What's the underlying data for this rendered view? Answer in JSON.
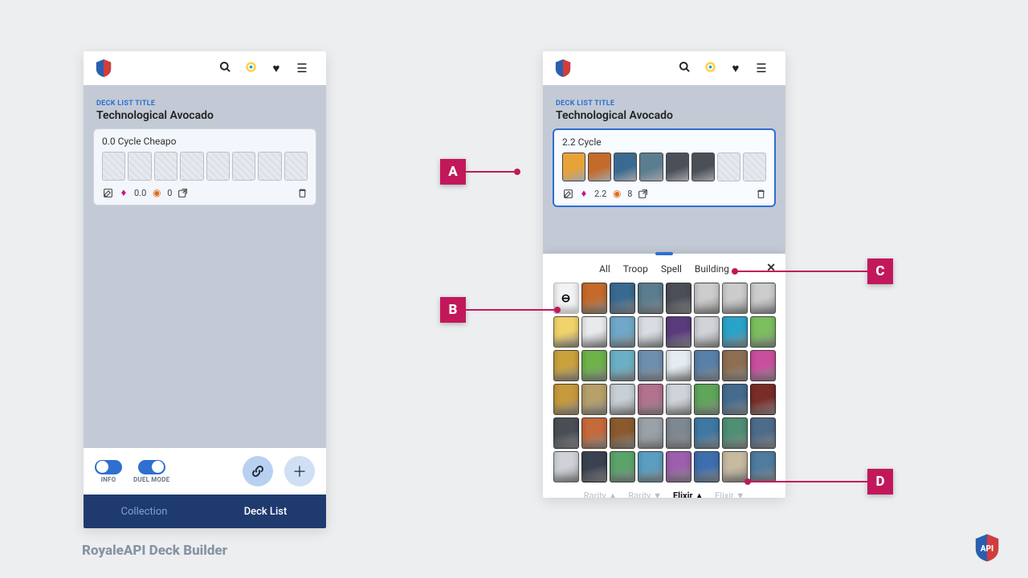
{
  "footer": {
    "title": "RoyaleAPI Deck Builder"
  },
  "section_label": "DECK LIST TITLE",
  "deck_list_title": "Technological Avocado",
  "left": {
    "deck_name": "0.0 Cycle Cheapo",
    "elixir": "0.0",
    "cycle": "0",
    "toggles": {
      "info": "INFO",
      "duel": "DUEL MODE"
    },
    "tabs": {
      "collection": "Collection",
      "decklist": "Deck List"
    }
  },
  "right": {
    "deck_name": "2.2 Cycle",
    "elixir": "2.2",
    "cycle": "8",
    "picker_tabs": {
      "all": "All",
      "troop": "Troop",
      "spell": "Spell",
      "building": "Building"
    },
    "sort": {
      "rarity_asc": "Rarity ▲",
      "rarity_desc": "Rarity ▼",
      "elixir_asc": "Elixir ▲",
      "elixir_desc": "Elixir ▼"
    }
  },
  "callouts": {
    "a": "A",
    "b": "B",
    "c": "C",
    "d": "D"
  },
  "card_palette": [
    "#e8a23a",
    "#c46b2c",
    "#3a6a91",
    "#5a7d8f",
    "#4b4f57",
    "#ccc",
    "#ccc",
    "#ccc",
    "#f2d36b",
    "#e8eaed",
    "#6fa8c9",
    "#d9dde2",
    "#5a3c7d",
    "#d0d3d8",
    "#2aa3c9",
    "#7bbf5e",
    "#caa23d",
    "#6eb24a",
    "#6bb0c6",
    "#6f8fae",
    "#e6edf2",
    "#5880a8",
    "#8e6f52",
    "#c94f9e",
    "#c79a3b",
    "#b7a06a",
    "#c8cfd6",
    "#b3728e",
    "#cfd4da",
    "#5fa55a",
    "#456c8e",
    "#7a2d28",
    "#4a4f56",
    "#c56a3a",
    "#8a5a2e",
    "#9aa1a8",
    "#7f8890",
    "#3e78a3",
    "#4f8f74",
    "#4e6b89",
    "#cfd3d8",
    "#3a4250",
    "#5aa36a",
    "#5a9ec2",
    "#9d5fae",
    "#3d6fae",
    "#c7baa0",
    "#4f7b9e"
  ],
  "deck_palette": [
    "#e8a23a",
    "#c46b2c",
    "#3a6a91",
    "#5a7d8f",
    "#4b4f57",
    "#4b4f57"
  ]
}
